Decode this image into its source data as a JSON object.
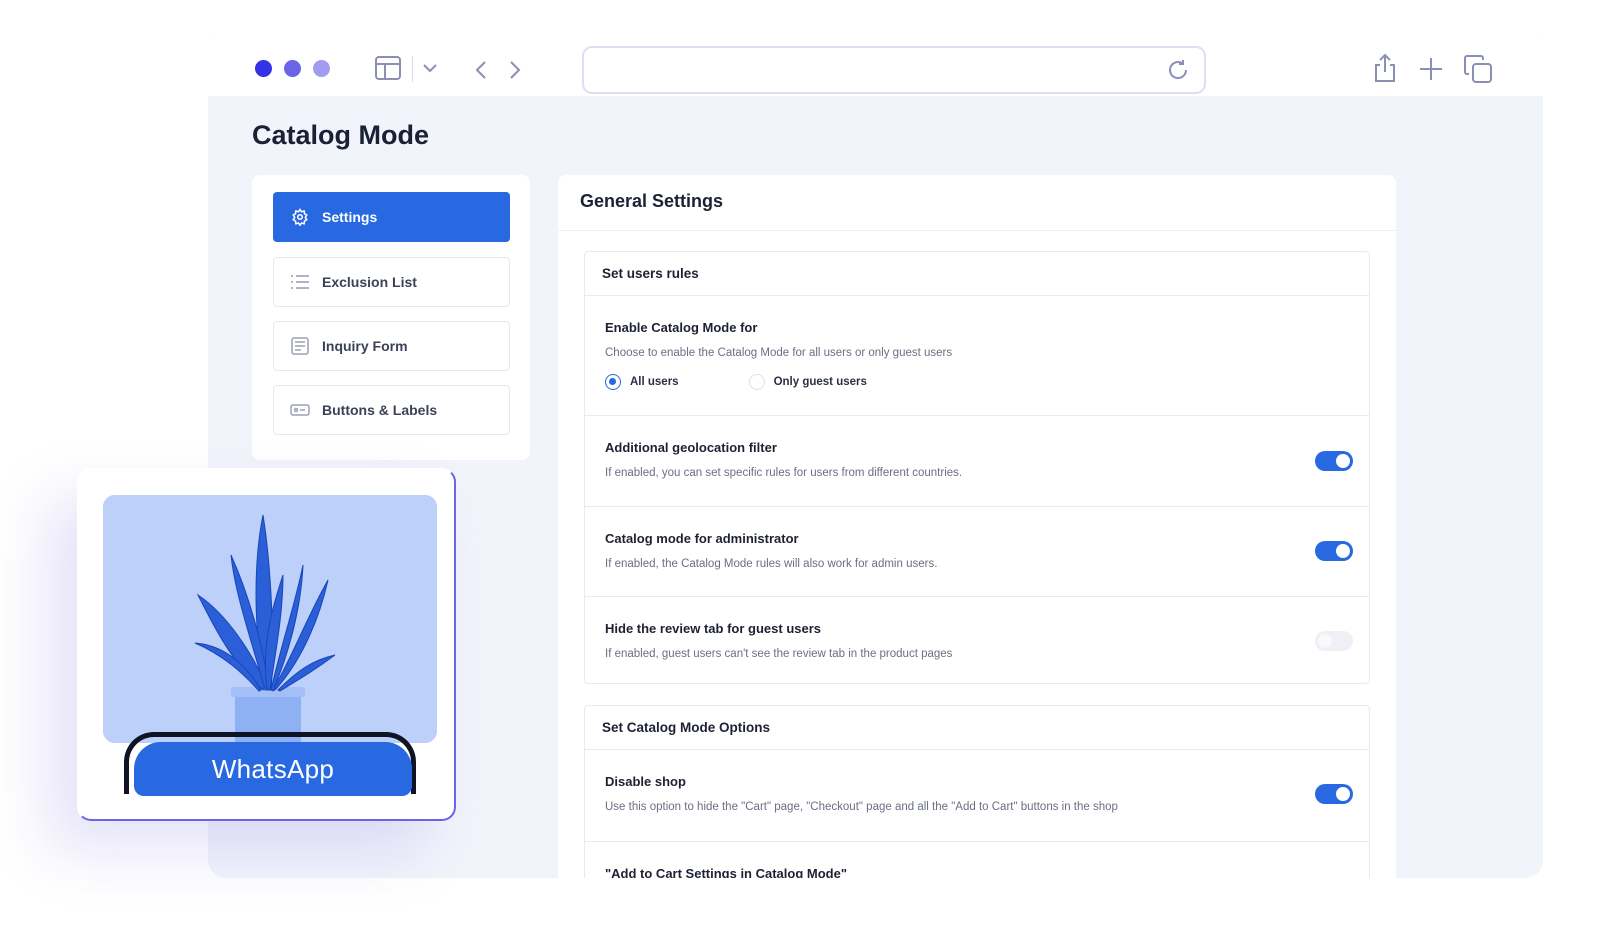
{
  "page": {
    "title": "Catalog Mode"
  },
  "chrome": {
    "url": ""
  },
  "sidebar": {
    "items": [
      {
        "label": "Settings",
        "icon": "gear-icon",
        "active": true
      },
      {
        "label": "Exclusion List",
        "icon": "list-icon",
        "active": false
      },
      {
        "label": "Inquiry Form",
        "icon": "form-icon",
        "active": false
      },
      {
        "label": "Buttons & Labels",
        "icon": "button-icon",
        "active": false
      }
    ]
  },
  "main": {
    "title": "General Settings",
    "users_rules": {
      "heading": "Set users rules",
      "enable_for": {
        "title": "Enable Catalog Mode for",
        "description": "Choose to enable the Catalog Mode for all users or only guest users",
        "options": [
          "All users",
          "Only guest users"
        ],
        "selected": "All users"
      },
      "geolocation": {
        "title": "Additional geolocation filter",
        "description": "If enabled, you can set specific rules for users from different countries.",
        "enabled": true
      },
      "administrator": {
        "title": "Catalog mode for administrator",
        "description": "If enabled, the Catalog Mode rules will also work for admin users.",
        "enabled": true
      },
      "review_tab": {
        "title": "Hide the review tab for guest users",
        "description": "If enabled, guest users can't see the review tab in the product pages",
        "enabled": false
      }
    },
    "options": {
      "heading": "Set Catalog Mode Options",
      "disable_shop": {
        "title": "Disable shop",
        "description": "Use this option to hide the \"Cart\" page, \"Checkout\" page and all the \"Add to Cart\" buttons in the shop",
        "enabled": true
      },
      "add_to_cart": {
        "title": "\"Add to Cart Settings in Catalog Mode\""
      }
    }
  },
  "overlay": {
    "button_label": "WhatsApp"
  },
  "colors": {
    "accent": "#2868e0",
    "dot1": "#3333e6",
    "dot2": "#6b63e8",
    "dot3": "#a39bf0"
  }
}
